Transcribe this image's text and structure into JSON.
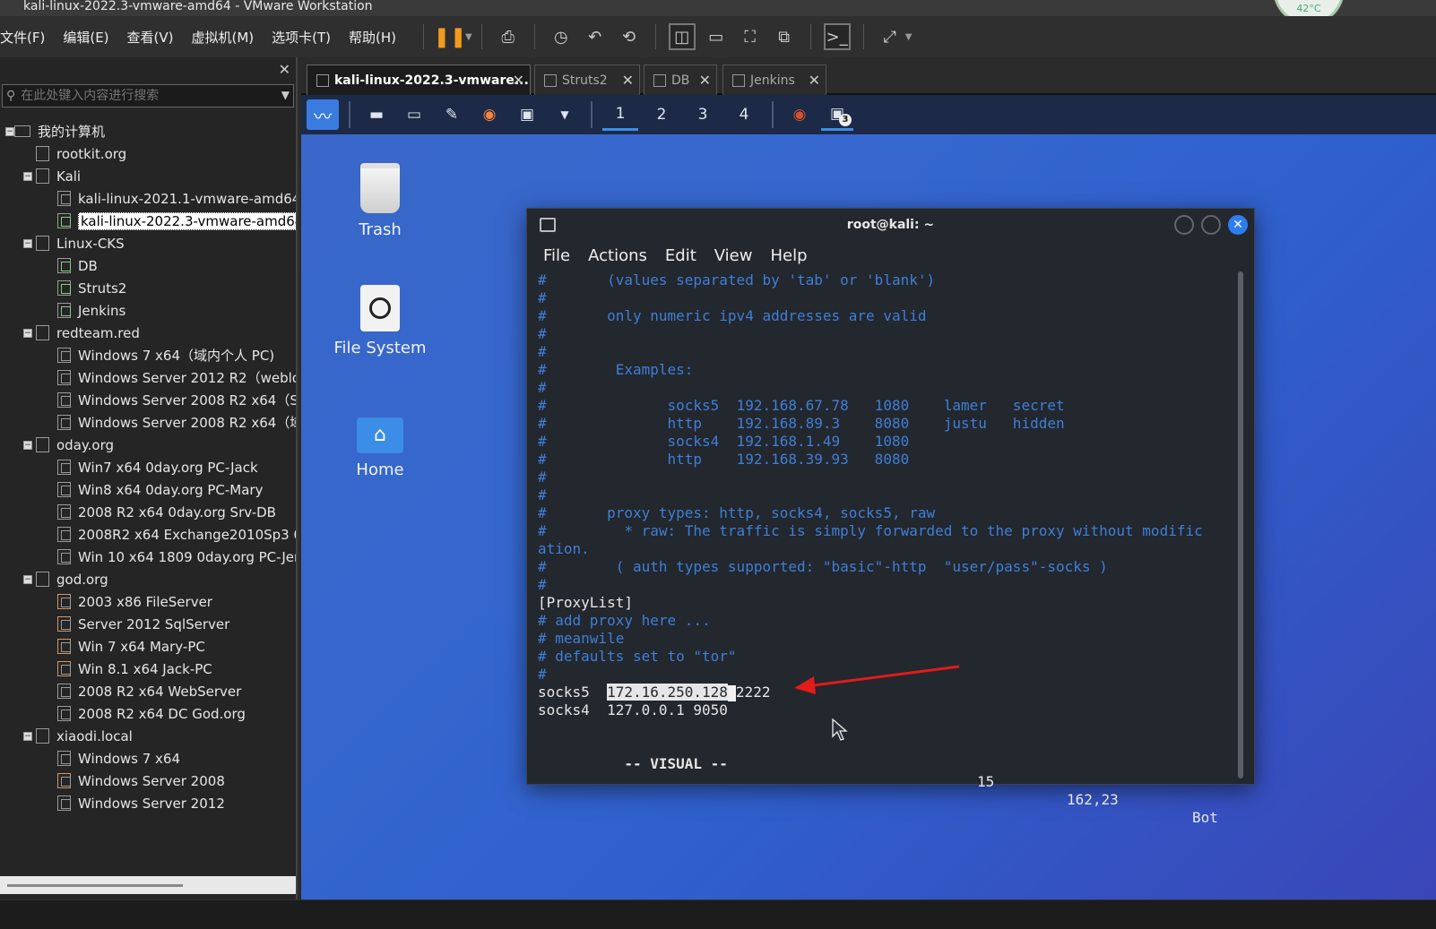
{
  "window": {
    "title": "kali-linux-2022.3-vmware-amd64 - VMware Workstation",
    "temperature": "42°C"
  },
  "menubar": {
    "items": [
      "文件(F)",
      "编辑(E)",
      "查看(V)",
      "虚拟机(M)",
      "选项卡(T)",
      "帮助(H)"
    ]
  },
  "library": {
    "search_placeholder": "在此处键入内容进行搜索",
    "tree": [
      {
        "label": "我的计算机",
        "level": 0,
        "toggle": "−",
        "icon": "pc"
      },
      {
        "label": "rootkit.org",
        "level": 1,
        "toggle": "",
        "icon": "folder"
      },
      {
        "label": "Kali",
        "level": 1,
        "toggle": "−",
        "icon": "folder"
      },
      {
        "label": "kali-linux-2021.1-vmware-amd64",
        "level": 2,
        "toggle": "",
        "icon": "vm"
      },
      {
        "label": "kali-linux-2022.3-vmware-amd64",
        "level": 2,
        "toggle": "",
        "icon": "vm-run",
        "selected": true
      },
      {
        "label": "Linux-CKS",
        "level": 1,
        "toggle": "−",
        "icon": "folder"
      },
      {
        "label": "DB",
        "level": 2,
        "toggle": "",
        "icon": "vm-run"
      },
      {
        "label": "Struts2",
        "level": 2,
        "toggle": "",
        "icon": "vm-run"
      },
      {
        "label": "Jenkins",
        "level": 2,
        "toggle": "",
        "icon": "vm-run"
      },
      {
        "label": "redteam.red",
        "level": 1,
        "toggle": "−",
        "icon": "folder"
      },
      {
        "label": "Windows 7 x64（域内个人 PC)",
        "level": 2,
        "toggle": "",
        "icon": "vm"
      },
      {
        "label": "Windows Server 2012 R2（weblo",
        "level": 2,
        "toggle": "",
        "icon": "vm"
      },
      {
        "label": "Windows Server 2008 R2 x64（S(",
        "level": 2,
        "toggle": "",
        "icon": "vm"
      },
      {
        "label": "Windows Server 2008 R2 x64（域",
        "level": 2,
        "toggle": "",
        "icon": "vm"
      },
      {
        "label": "oday.org",
        "level": 1,
        "toggle": "−",
        "icon": "folder"
      },
      {
        "label": "Win7 x64 0day.org PC-Jack",
        "level": 2,
        "toggle": "",
        "icon": "vm"
      },
      {
        "label": "Win8 x64 0day.org PC-Mary",
        "level": 2,
        "toggle": "",
        "icon": "vm"
      },
      {
        "label": "2008 R2 x64 0day.org Srv-DB",
        "level": 2,
        "toggle": "",
        "icon": "vm"
      },
      {
        "label": "2008R2 x64 Exchange2010Sp3 0c",
        "level": 2,
        "toggle": "",
        "icon": "vm"
      },
      {
        "label": "Win 10 x64 1809 0day.org PC-Jer",
        "level": 2,
        "toggle": "",
        "icon": "vm"
      },
      {
        "label": "god.org",
        "level": 1,
        "toggle": "−",
        "icon": "folder"
      },
      {
        "label": "2003 x86 FileServer",
        "level": 2,
        "toggle": "",
        "icon": "vm-srv"
      },
      {
        "label": "Server 2012 SqlServer",
        "level": 2,
        "toggle": "",
        "icon": "vm-srv"
      },
      {
        "label": "Win 7 x64 Mary-PC",
        "level": 2,
        "toggle": "",
        "icon": "vm-srv"
      },
      {
        "label": "Win 8.1 x64 Jack-PC",
        "level": 2,
        "toggle": "",
        "icon": "vm-srv"
      },
      {
        "label": "2008 R2 x64 WebServer",
        "level": 2,
        "toggle": "",
        "icon": "vm"
      },
      {
        "label": "2008 R2 x64 DC God.org",
        "level": 2,
        "toggle": "",
        "icon": "vm"
      },
      {
        "label": "xiaodi.local",
        "level": 1,
        "toggle": "−",
        "icon": "folder"
      },
      {
        "label": "Windows 7 x64",
        "level": 2,
        "toggle": "",
        "icon": "vm"
      },
      {
        "label": "Windows Server 2008",
        "level": 2,
        "toggle": "",
        "icon": "vm-srv"
      },
      {
        "label": "Windows Server 2012",
        "level": 2,
        "toggle": "",
        "icon": "vm"
      }
    ]
  },
  "tabs": [
    {
      "label": "kali-linux-2022.3-vmware...",
      "active": true
    },
    {
      "label": "Struts2",
      "active": false
    },
    {
      "label": "DB",
      "active": false
    },
    {
      "label": "Jenkins",
      "active": false
    }
  ],
  "kali_panel": {
    "workspaces": [
      "1",
      "2",
      "3",
      "4"
    ],
    "current_workspace": "1",
    "terminal_badge": "3"
  },
  "desktop_icons": [
    "Trash",
    "File System",
    "Home"
  ],
  "terminal": {
    "title": "root@kali: ~",
    "menu": [
      "File",
      "Actions",
      "Edit",
      "View",
      "Help"
    ],
    "lines": [
      "#       (values separated by 'tab' or 'blank')",
      "#",
      "#       only numeric ipv4 addresses are valid",
      "#",
      "#",
      "#        Examples:",
      "#",
      "#              socks5  192.168.67.78   1080    lamer   secret",
      "#              http    192.168.89.3    8080    justu   hidden",
      "#              socks4  192.168.1.49    1080",
      "#              http    192.168.39.93   8080",
      "#",
      "#",
      "#       proxy types: http, socks4, socks5, raw",
      "#         * raw: The traffic is simply forwarded to the proxy without modific",
      "ation.",
      "#        ( auth types supported: \"basic\"-http  \"user/pass\"-socks )",
      "#",
      "[ProxyList]",
      "# add proxy here ...",
      "# meanwile",
      "# defaults set to \"tor\"",
      "#"
    ],
    "proxy_line": {
      "type": "socks5",
      "ip": "172.16.250.128",
      "port": "2222"
    },
    "proxy_line2": "socks4  127.0.0.1 9050",
    "status": {
      "mode": "-- VISUAL --",
      "count": "15",
      "position": "162,23",
      "scroll": "Bot"
    }
  }
}
